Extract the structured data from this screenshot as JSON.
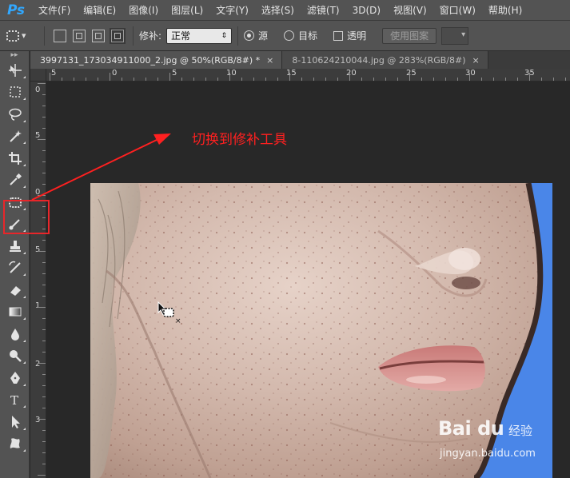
{
  "app": {
    "logo": "Ps"
  },
  "menubar": {
    "items": [
      "文件(F)",
      "编辑(E)",
      "图像(I)",
      "图层(L)",
      "文字(Y)",
      "选择(S)",
      "滤镜(T)",
      "3D(D)",
      "视图(V)",
      "窗口(W)",
      "帮助(H)"
    ]
  },
  "options": {
    "patch_label": "修补:",
    "patch_value": "正常",
    "source_label": "源",
    "target_label": "目标",
    "transparent_label": "透明",
    "use_pattern_label": "使用图案",
    "source_selected": true
  },
  "tabs": [
    {
      "label": "3997131_173034911000_2.jpg @ 50%(RGB/8#) *",
      "close": "×",
      "active": true
    },
    {
      "label": "8-110624210044.jpg @ 283%(RGB/8#)",
      "close": "×",
      "active": false
    }
  ],
  "ruler_top": [
    "5",
    "0",
    "5",
    "10",
    "15",
    "20",
    "25",
    "30",
    "35"
  ],
  "ruler_left": [
    "0",
    "5",
    "0",
    "5",
    "1",
    "2",
    "3"
  ],
  "tools": [
    "move-tool",
    "marquee-tool",
    "lasso-tool",
    "magic-wand-tool",
    "crop-tool",
    "eyedropper-tool",
    "patch-tool",
    "brush-tool",
    "clone-stamp-tool",
    "history-brush-tool",
    "eraser-tool",
    "gradient-tool",
    "blur-tool",
    "dodge-tool",
    "pen-tool",
    "type-tool",
    "path-selection-tool",
    "custom-shape-tool"
  ],
  "annotation": {
    "text": "切换到修补工具",
    "color": "#ff2020"
  },
  "watermark": {
    "brand": "Bai du",
    "cn": "经验",
    "url": "jingyan.baidu.com"
  },
  "colors": {
    "accent": "#31a8ff",
    "panel": "#535353",
    "canvas": "#282828",
    "highlight": "#e8262a",
    "photo_background": "#4a86e8"
  }
}
